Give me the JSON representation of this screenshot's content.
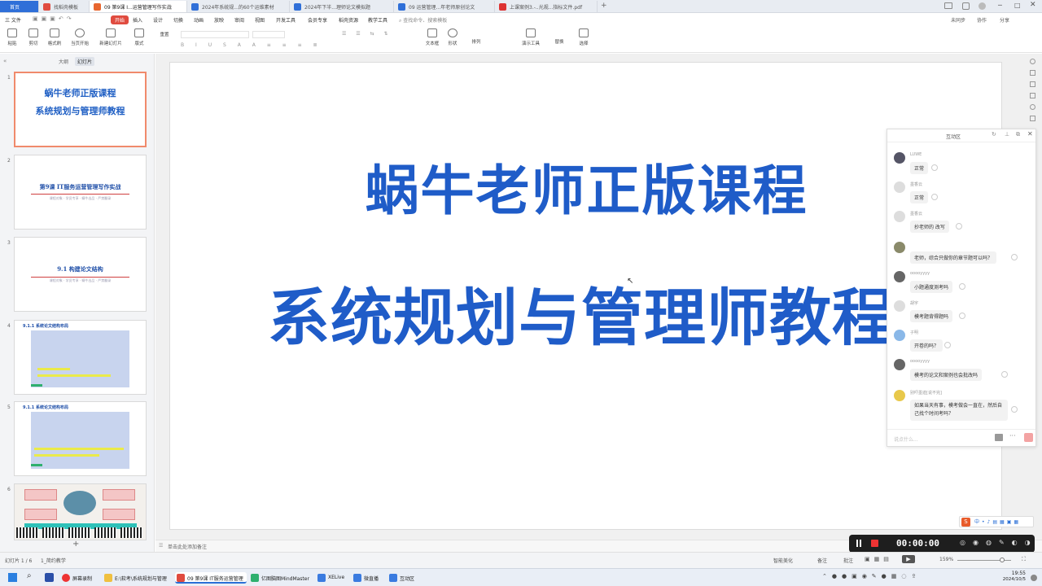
{
  "tabs": [
    {
      "label": "首页"
    },
    {
      "label": "找稻壳模板"
    },
    {
      "label": "09 第9课 I...运营管理写作实战"
    },
    {
      "label": "2024年系统规...的60个运维素材"
    },
    {
      "label": "2024年下半...理师论文模拟题"
    },
    {
      "label": "09 运营管理...年老师原创论文"
    },
    {
      "label": "上课案例3.-..光规...指标文件.pdf"
    }
  ],
  "titlebar_right": {
    "notes": "未同步",
    "collab": "协作",
    "share": "分享"
  },
  "menu": {
    "file": "三 文件",
    "items": [
      "开始",
      "插入",
      "设计",
      "切换",
      "动画",
      "放映",
      "审阅",
      "视图",
      "开发工具",
      "会员专享",
      "稻壳资源",
      "教学工具"
    ],
    "search": "查找命令、搜索模板"
  },
  "ribbon": [
    "粘贴",
    "剪切",
    "格式刷",
    "当页开始",
    "新建幻灯片",
    "版式",
    "重置",
    "文本框",
    "形状",
    "排列",
    "演示工具",
    "替换",
    "选择"
  ],
  "left_panel": {
    "tab_outline": "大纲",
    "tab_slides": "幻灯片",
    "slides": [
      {
        "num": "1",
        "line1": "蜗牛老师正版课程",
        "line2": "系统规划与管理师教程"
      },
      {
        "num": "2",
        "title": "第9课 IT服务运营管理写作实战",
        "sub": "课程对象 · 学员专享 · 蜗牛出品 · 严禁翻录"
      },
      {
        "num": "3",
        "title": "9.1 构建论文结构",
        "sub": "课程对象 · 学员专享 · 蜗牛出品 · 严禁翻录"
      },
      {
        "num": "4",
        "title": "9.1.1 系统论文结构布局"
      },
      {
        "num": "5",
        "title": "9.1.1 系统论文结构布局"
      },
      {
        "num": "6"
      }
    ]
  },
  "slide": {
    "line1": "蜗牛老师正版课程",
    "line2": "系统规划与管理师教程",
    "color": "#1f5cc8"
  },
  "chat": {
    "title": "互动区",
    "messages": [
      {
        "user": "LUWE",
        "text": "正常"
      },
      {
        "user": "墨香云",
        "text": "正常"
      },
      {
        "user": "墨香云",
        "text": "抄老师的 改写"
      },
      {
        "user": "",
        "text": "老师，综合只做你的章节题可以吗？"
      },
      {
        "user": "ooooyyyy",
        "text": "小题通度测考吗"
      },
      {
        "user": "胡宇",
        "text": "模考题背得题吗"
      },
      {
        "user": "子明",
        "text": "开卷的吗？"
      },
      {
        "user": "ooooyyyy",
        "text": "模考的论文和案例也会批改吗"
      },
      {
        "user": "别吓墨迹[说不完]",
        "text": "如果当天有事，模考做会一直在，然后自己找个时间考吗？"
      }
    ],
    "input_placeholder": "说点什么..."
  },
  "notes_placeholder": "单击此处添加备注",
  "status": {
    "slide_counter": "幻灯片 1 / 6",
    "theme": "1_简约教学",
    "smart": "智能美化",
    "notes": "备注",
    "comment": "批注",
    "zoom": "159%"
  },
  "recorder": {
    "time": "00:00:00"
  },
  "taskbar": {
    "apps": [
      "屏幕录制",
      "E:\\软考\\系统规划与管理",
      "09 第9课 IT服务运营管理",
      "亿图脑图MindMaster",
      "XELive",
      "微直播",
      "互动区"
    ],
    "time": "19:55",
    "date": "2024/10/5"
  },
  "colors": {
    "accent": "#e04b3f",
    "slide_blue": "#1f5cc8"
  }
}
